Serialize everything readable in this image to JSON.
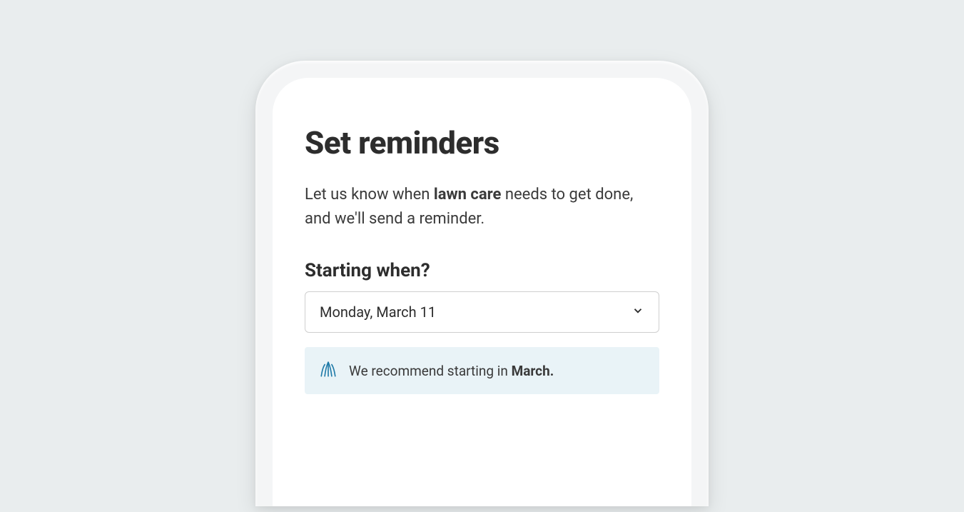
{
  "title": "Set reminders",
  "subtitle": {
    "prefix": "Let us know when ",
    "bold": "lawn care",
    "suffix": " needs to get done, and we'll send a reminder."
  },
  "starting": {
    "label": "Starting when?",
    "value": "Monday, March 11"
  },
  "tip": {
    "prefix": "We recommend starting in ",
    "bold": "March."
  }
}
